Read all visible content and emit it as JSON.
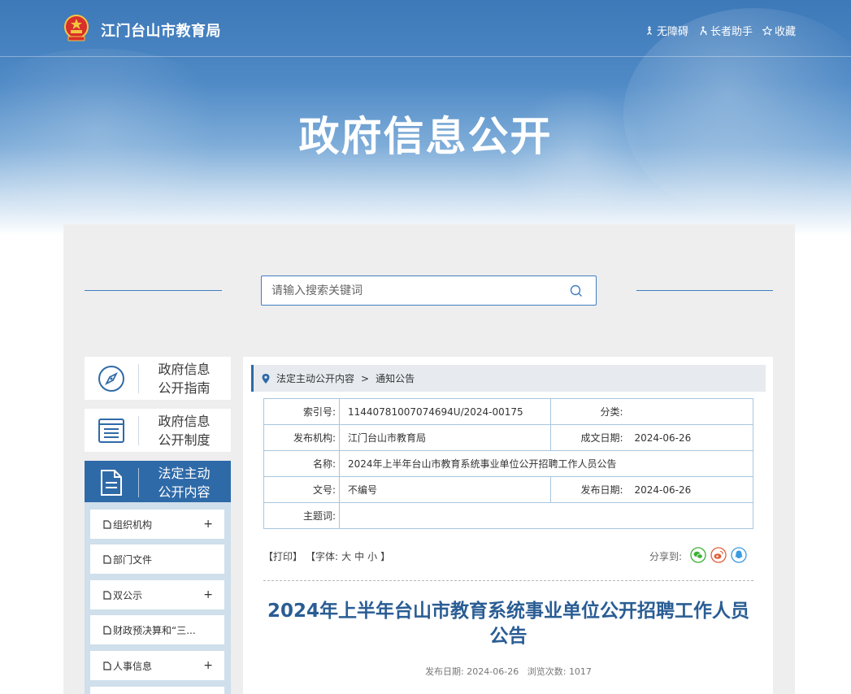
{
  "header": {
    "site_name": "江门台山市教育局",
    "links": [
      {
        "icon": "accessibility-icon",
        "label": "无障碍"
      },
      {
        "icon": "elder-helper-icon",
        "label": "长者助手"
      },
      {
        "icon": "star-icon",
        "label": "收藏"
      }
    ],
    "banner_title": "政府信息公开"
  },
  "search": {
    "placeholder": "请输入搜索关键词"
  },
  "sidebar": {
    "cards": [
      {
        "label": "政府信息公开指南",
        "icon": "compass-icon"
      },
      {
        "label": "政府信息公开制度",
        "icon": "list-icon"
      },
      {
        "label": "法定主动公开内容",
        "icon": "document-icon"
      }
    ],
    "items": [
      {
        "label": "组织机构",
        "expand": "+"
      },
      {
        "label": "部门文件",
        "expand": ""
      },
      {
        "label": "双公示",
        "expand": "+"
      },
      {
        "label": "财政预决算和“三...",
        "expand": ""
      },
      {
        "label": "人事信息",
        "expand": "+"
      }
    ]
  },
  "breadcrumb": {
    "level1": "法定主动公开内容",
    "separator": ">",
    "level2": "通知公告"
  },
  "meta": {
    "index_label": "索引号:",
    "index_value": "11440781007074694U/2024-00175",
    "category_label": "分类:",
    "category_value": "",
    "publisher_label": "发布机构:",
    "publisher_value": "江门台山市教育局",
    "created_label": "成文日期:",
    "created_value": "2024-06-26",
    "name_label": "名称:",
    "name_value": "2024年上半年台山市教育系统事业单位公开招聘工作人员公告",
    "docno_label": "文号:",
    "docno_value": "不编号",
    "published_label": "发布日期:",
    "published_value": "2024-06-26",
    "subject_label": "主题词:",
    "subject_value": ""
  },
  "tools": {
    "print": "【打印】",
    "font_prefix": "【字体:",
    "font_large": "大",
    "font_medium": "中",
    "font_small": "小",
    "font_suffix": "】",
    "share_label": "分享到:"
  },
  "article": {
    "title": "2024年上半年台山市教育系统事业单位公开招聘工作人员公告",
    "date_label": "发布日期:",
    "date_value": "2024-06-26",
    "views_label": "浏览次数:",
    "views_value": "1017"
  },
  "colors": {
    "brand": "#2f6aa8",
    "title": "#2a5d94",
    "wechat": "#3cb034",
    "weibo": "#e0603a",
    "qq": "#3a9be0"
  }
}
